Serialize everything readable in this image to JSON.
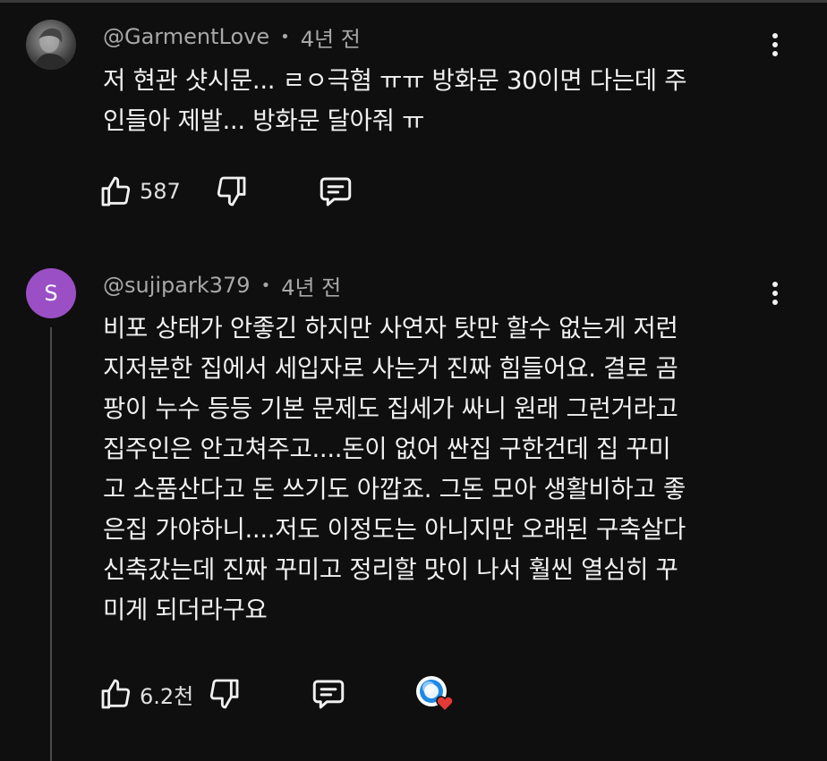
{
  "comments": [
    {
      "author": "@GarmentLove",
      "time": "4년 전",
      "text": "저 현관 샷시문... ㄹㅇ극혐 ㅠㅠ 방화문 30이면 다는데 주\n인들아 제발... 방화문 달아줘 ㅠ",
      "likes": "587",
      "avatar_icon": "user-photo-avatar"
    },
    {
      "author": "@sujipark379",
      "time": "4년 전",
      "avatar_letter": "S",
      "avatar_color": "#9b4fc5",
      "text": "비포 상태가 안좋긴 하지만 사연자 탓만 할수 없는게 저런\n지저분한 집에서 세입자로 사는거 진짜 힘들어요. 결로 곰\n팡이 누수 등등 기본 문제도 집세가 싸니 원래 그런거라고\n집주인은 안고쳐주고....돈이 없어 싼집 구한건데 집 꾸미\n고 소품산다고 돈 쓰기도 아깝죠. 그돈 모아 생활비하고 좋\n은집 가야하니....저도 이정도는 아니지만 오래된 구축살다\n신축갔는데 진짜 꾸미고 정리할 맛이 나서 훨씬 열심히 꾸\n미게 되더라구요",
      "likes": "6.2천"
    }
  ],
  "icons": {
    "like": "thumbs-up-icon",
    "dislike": "thumbs-down-icon",
    "reply": "reply-comment-icon",
    "more": "more-vertical-icon",
    "creator_heart": "creator-heart-icon"
  },
  "colors": {
    "background": "#0f0f0f",
    "text": "#f1f1f1",
    "meta": "#a8a8a8",
    "heart": "#e53935"
  }
}
